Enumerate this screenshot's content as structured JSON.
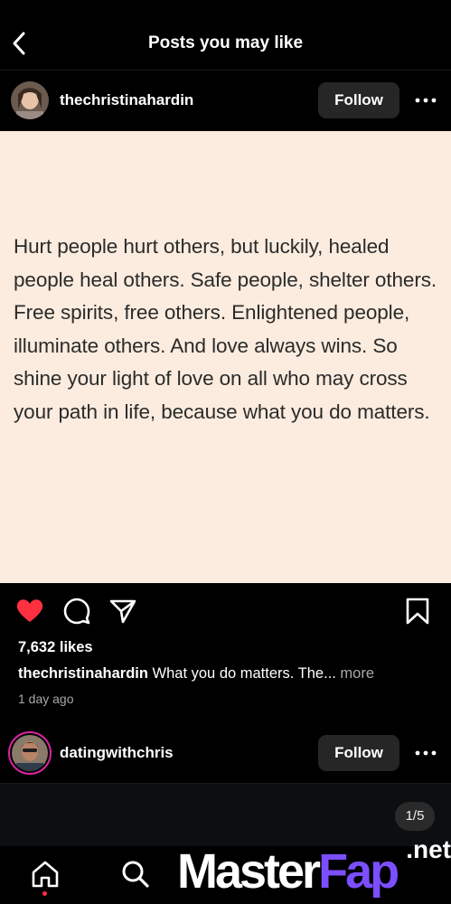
{
  "header": {
    "title": "Posts you may like"
  },
  "post1": {
    "username": "thechristinahardin",
    "follow_label": "Follow",
    "quote": "Hurt people hurt others, but luckily, healed people heal others. Safe people, shelter others. Free spirits, free others. Enlightened people, illuminate others. And love always wins. So shine your light of love on all who may cross your path in life, because what you do matters.",
    "likes": "7,632 likes",
    "caption_user": "thechristinahardin",
    "caption_text": " What you do matters. The... ",
    "caption_more": "more",
    "timestamp": "1 day ago",
    "liked": true
  },
  "post2": {
    "username": "datingwithchris",
    "follow_label": "Follow",
    "page_indicator": "1/5"
  },
  "watermark": {
    "master": "Master",
    "fap": "Fap",
    "net": ".net"
  },
  "bottom_text": "",
  "colors": {
    "like": "#ff3040",
    "quote_bg": "#fbecdf",
    "button_bg": "#262626",
    "watermark_fap": "#7b4fff"
  },
  "icons": [
    "chevron-left-icon",
    "more-horizontal-icon",
    "heart-icon",
    "comment-icon",
    "share-icon",
    "bookmark-icon",
    "home-icon",
    "search-icon"
  ]
}
